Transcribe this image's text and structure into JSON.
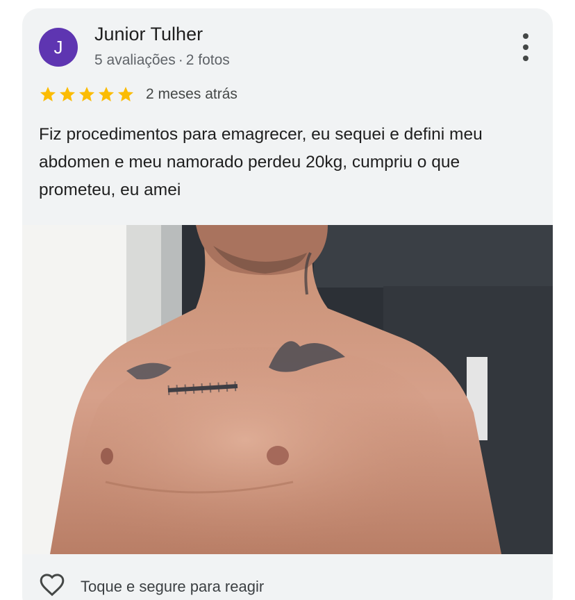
{
  "review": {
    "avatar_initial": "J",
    "author": "Junior Tulher",
    "reviews_count": "5 avaliações",
    "separator": "·",
    "photos_count": "2 fotos",
    "rating": 5,
    "date": "2 meses atrás",
    "text": "Fiz procedimentos para emagrecer, eu sequei e defini meu abdomen e meu namorado perdeu 20kg, cumpriu o que prometeu, eu amei"
  },
  "footer": {
    "react_label": "Toque e segure para reagir"
  },
  "colors": {
    "avatar": "#5e35b1",
    "star": "#fbbc04",
    "card_bg": "#f1f3f4"
  },
  "icons": [
    "more-vert-icon",
    "star-icon",
    "heart-outline-icon"
  ]
}
